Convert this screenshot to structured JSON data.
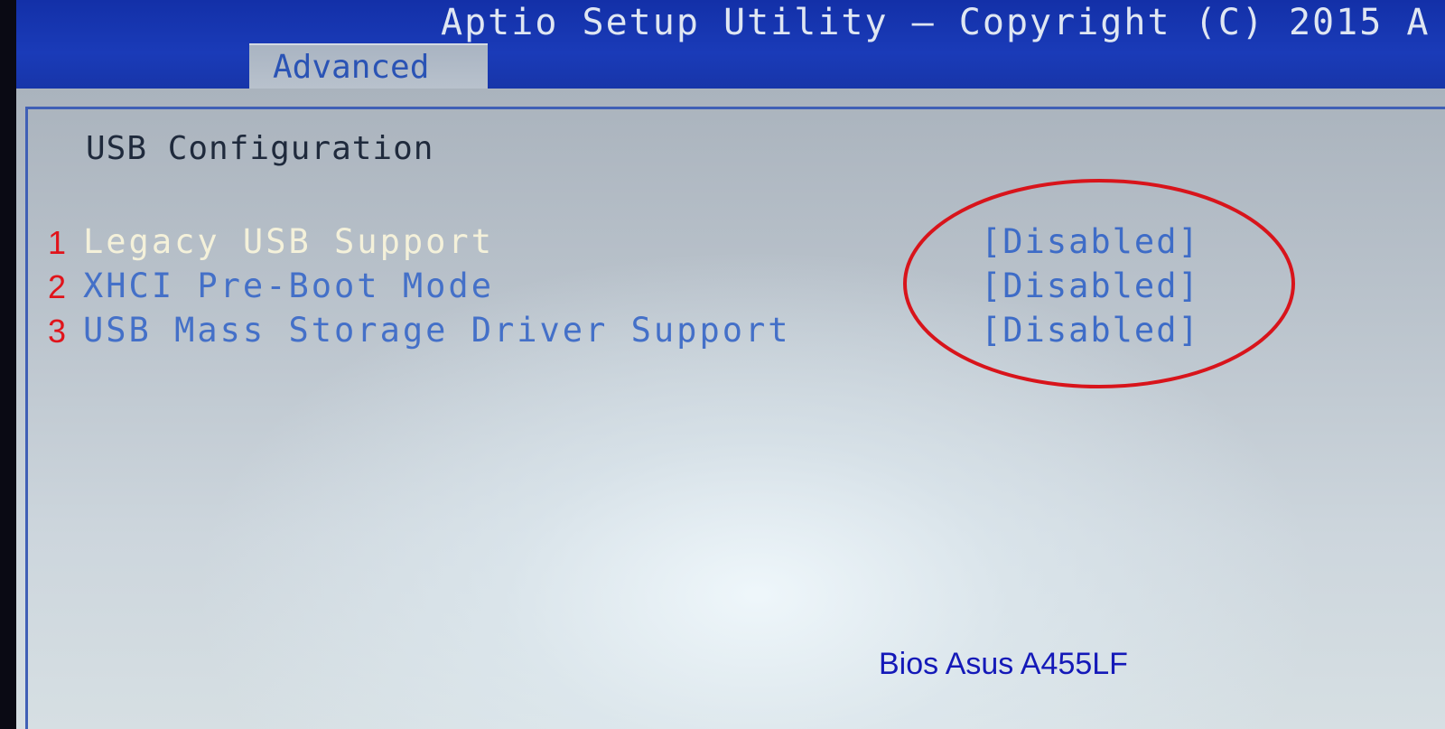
{
  "header": {
    "title": "Aptio Setup Utility – Copyright (C) 2015 A",
    "active_tab": "Advanced"
  },
  "section": {
    "title": "USB Configuration"
  },
  "settings": [
    {
      "num": "1",
      "label": "Legacy USB Support",
      "value": "[Disabled]",
      "selected": true
    },
    {
      "num": "2",
      "label": "XHCI Pre-Boot Mode",
      "value": "[Disabled]",
      "selected": false
    },
    {
      "num": "3",
      "label": "USB Mass Storage Driver Support",
      "value": "[Disabled]",
      "selected": false
    }
  ],
  "caption": "Bios Asus A455LF",
  "colors": {
    "header_bg": "#1a3bb8",
    "panel_bg": "#c4ccd4",
    "selected_text": "#f4f1da",
    "option_text": "#4470c8",
    "annotation_red": "#d8141b",
    "caption_blue": "#1419b8"
  }
}
